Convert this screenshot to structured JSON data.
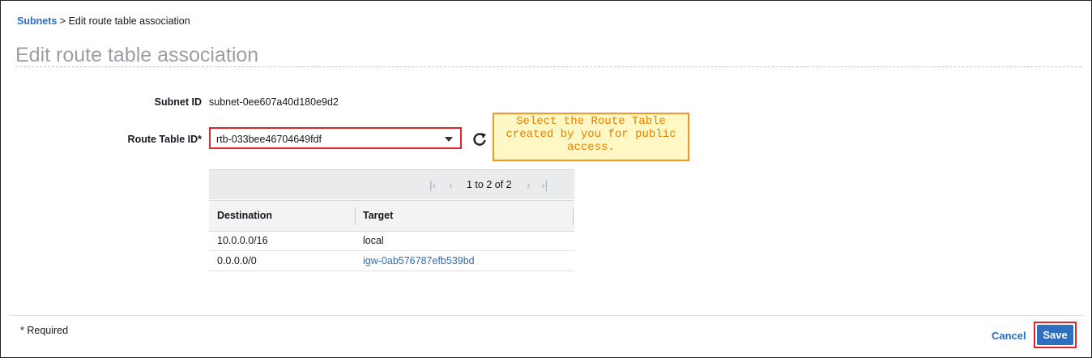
{
  "breadcrumb": {
    "link_label": "Subnets",
    "separator": ">",
    "current": "Edit route table association"
  },
  "page": {
    "title": "Edit route table association"
  },
  "form": {
    "subnet_id_label": "Subnet ID",
    "subnet_id_value": "subnet-0ee607a40d180e9d2",
    "route_table_label": "Route Table ID*",
    "route_table_value": "rtb-033bee46704649fdf",
    "refresh_icon": "refresh-icon"
  },
  "callout": {
    "text": "Select the Route Table created by you for public access."
  },
  "pagination": {
    "text": "1 to 2 of 2"
  },
  "table": {
    "columns": [
      "Destination",
      "Target"
    ],
    "rows": [
      {
        "destination": "10.0.0.0/16",
        "target": "local"
      },
      {
        "destination": "0.0.0.0/0",
        "target": "igw-0ab576787efb539bd"
      }
    ]
  },
  "footer": {
    "required_note": "* Required",
    "cancel_label": "Cancel",
    "save_label": "Save"
  },
  "colors": {
    "link": "#2a6ebb",
    "highlight_border": "#e0262c",
    "callout_border": "#f39423",
    "callout_text": "#e67e00",
    "primary_button": "#2e6fbf"
  }
}
